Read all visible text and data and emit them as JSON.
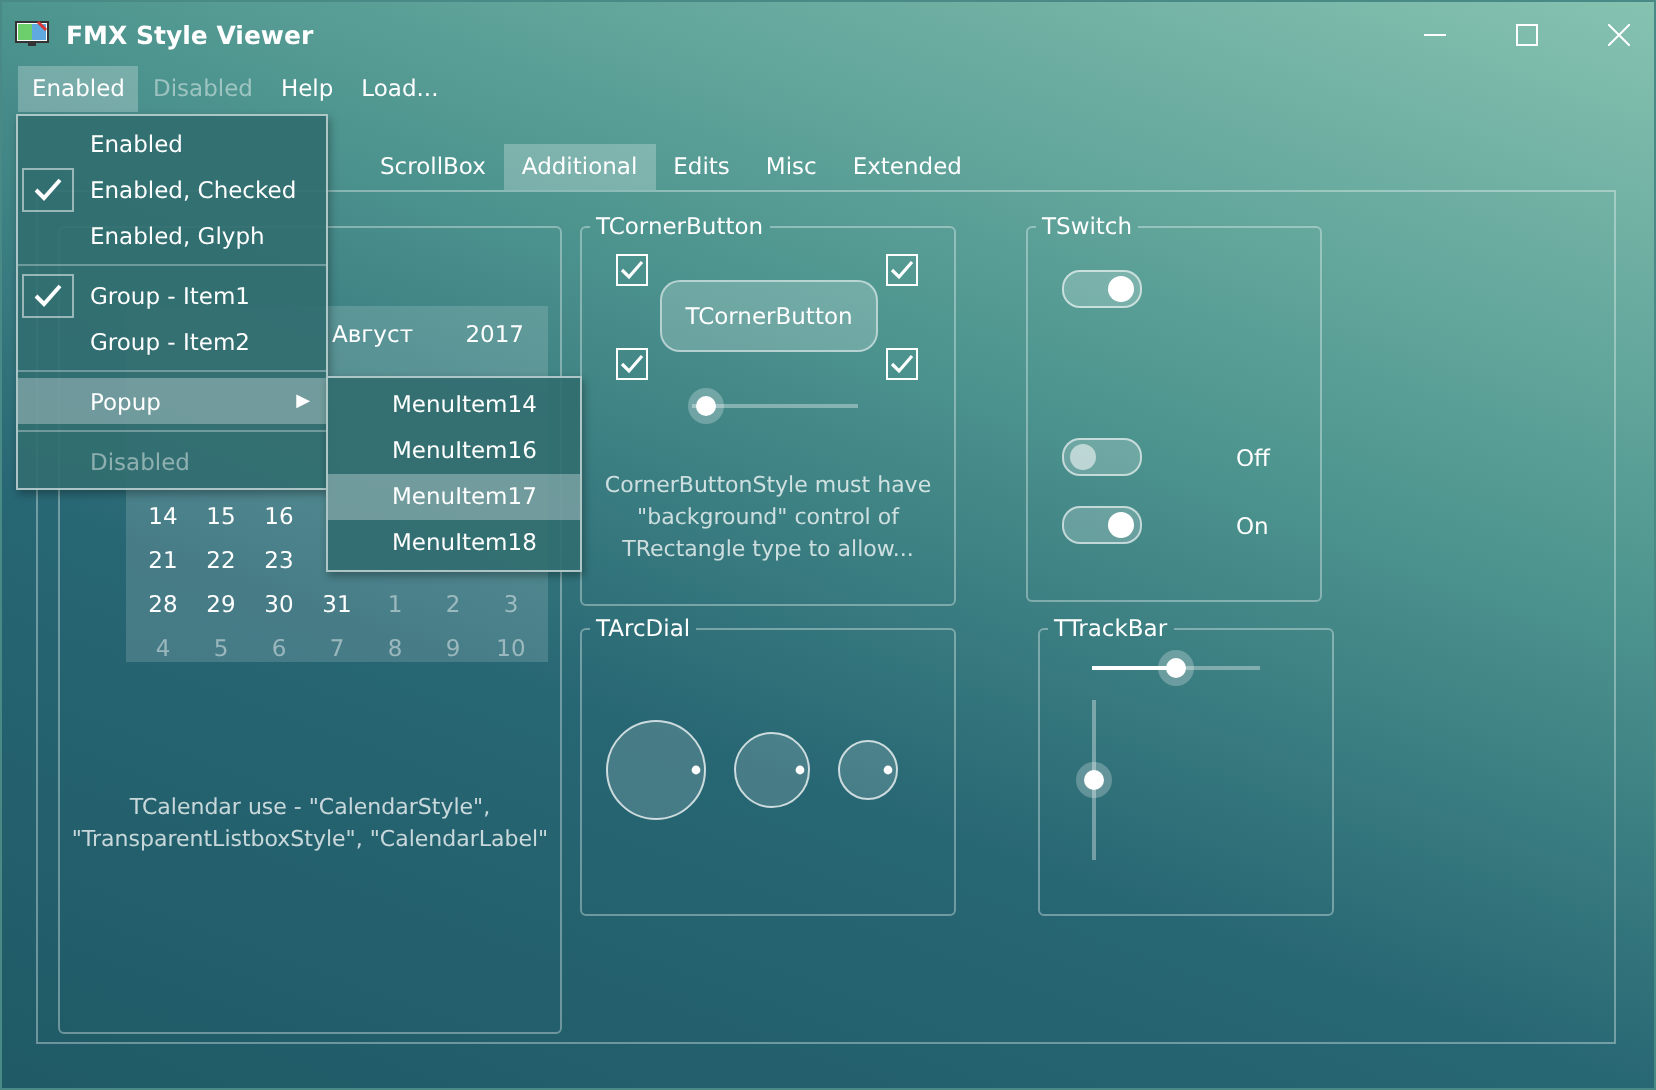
{
  "window": {
    "title": "FMX Style Viewer"
  },
  "menu_bar": [
    {
      "label": "Enabled",
      "selected": true,
      "disabled": false
    },
    {
      "label": "Disabled",
      "selected": false,
      "disabled": true
    },
    {
      "label": "Help",
      "selected": false,
      "disabled": false
    },
    {
      "label": "Load...",
      "selected": false,
      "disabled": false
    }
  ],
  "dropdown": [
    {
      "kind": "item",
      "label": "Enabled",
      "checked": false,
      "disabled": false,
      "selected": false
    },
    {
      "kind": "item",
      "label": "Enabled, Checked",
      "checked": true,
      "disabled": false,
      "selected": false
    },
    {
      "kind": "item",
      "label": "Enabled, Glyph",
      "checked": false,
      "disabled": false,
      "selected": false
    },
    {
      "kind": "separator"
    },
    {
      "kind": "item",
      "label": "Group - Item1",
      "checked": true,
      "disabled": false,
      "selected": false
    },
    {
      "kind": "item",
      "label": "Group - Item2",
      "checked": false,
      "disabled": false,
      "selected": false
    },
    {
      "kind": "separator"
    },
    {
      "kind": "submenu",
      "label": "Popup",
      "arrow": "▶",
      "checked": false,
      "disabled": false,
      "selected": true
    },
    {
      "kind": "separator"
    },
    {
      "kind": "item",
      "label": "Disabled",
      "checked": false,
      "disabled": true,
      "selected": false
    }
  ],
  "submenu": [
    {
      "label": "MenuItem14",
      "selected": false
    },
    {
      "label": "MenuItem16",
      "selected": false
    },
    {
      "label": "MenuItem17",
      "selected": true
    },
    {
      "label": "MenuItem18",
      "selected": false
    }
  ],
  "tabs": [
    {
      "label": "ScrollBox",
      "selected": false
    },
    {
      "label": "Additional",
      "selected": true
    },
    {
      "label": "Edits",
      "selected": false
    },
    {
      "label": "Misc",
      "selected": false
    },
    {
      "label": "Extended",
      "selected": false
    }
  ],
  "calendar": {
    "month": "Август",
    "year": "2017",
    "rows": [
      {
        "cells": [
          {
            "text": "14",
            "muted": false
          },
          {
            "text": "15",
            "muted": false
          },
          {
            "text": "16",
            "muted": false
          }
        ]
      },
      {
        "cells": [
          {
            "text": "21",
            "muted": false
          },
          {
            "text": "22",
            "muted": false
          },
          {
            "text": "23",
            "muted": false
          }
        ]
      },
      {
        "cells": [
          {
            "text": "28",
            "muted": false
          },
          {
            "text": "29",
            "muted": false
          },
          {
            "text": "30",
            "muted": false
          },
          {
            "text": "31",
            "muted": false
          },
          {
            "text": "1",
            "muted": true
          },
          {
            "text": "2",
            "muted": true
          },
          {
            "text": "3",
            "muted": true
          }
        ]
      },
      {
        "cells": [
          {
            "text": "4",
            "muted": true
          },
          {
            "text": "5",
            "muted": true
          },
          {
            "text": "6",
            "muted": true
          },
          {
            "text": "7",
            "muted": true
          },
          {
            "text": "8",
            "muted": true
          },
          {
            "text": "9",
            "muted": true
          },
          {
            "text": "10",
            "muted": true
          }
        ]
      }
    ],
    "caption": "TCalendar use - \"CalendarStyle\", \"TransparentListboxStyle\", \"CalendarLabel\""
  },
  "corner_button": {
    "title": "TCornerButton",
    "button": "TCornerButton",
    "corners": [
      {
        "checked": true
      },
      {
        "checked": true
      },
      {
        "checked": true
      },
      {
        "checked": true
      }
    ],
    "slider": {
      "level": 0.08
    },
    "note": "CornerButtonStyle must have \"background\" control of TRectangle type to allow..."
  },
  "switch_group": {
    "title": "TSwitch",
    "switches": [
      {
        "on": true
      },
      {
        "on": false,
        "label": "Off"
      },
      {
        "on": true,
        "label": "On"
      }
    ]
  },
  "arc_dial": {
    "title": "TArcDial"
  },
  "track_bar": {
    "title": "TTrackBar",
    "horizontal": {
      "level": 0.5
    },
    "vertical": {
      "level": 0.5
    }
  }
}
